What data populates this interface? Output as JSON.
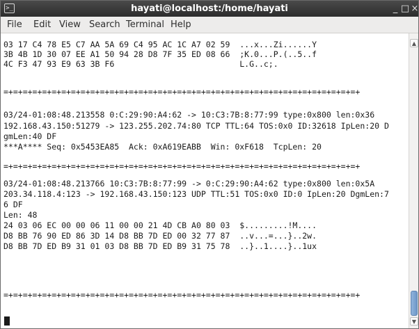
{
  "window": {
    "title": "hayati@localhost:/home/hayati",
    "app_icon": "terminal-icon",
    "minimize_glyph": "_",
    "maximize_glyph": "□",
    "close_glyph": "×"
  },
  "menu": [
    "File",
    "Edit",
    "View",
    "Search",
    "Terminal",
    "Help"
  ],
  "terminal": {
    "lines": [
      "03 17 C4 78 E5 C7 AA 5A 69 C4 95 AC 1C A7 02 59  ...x...Zi......Y",
      "3B 4B 1D 30 07 EE A1 50 94 28 D8 7F 35 ED 08 66  ;K.0...P.(..5..f",
      "4C F3 47 93 E9 63 3B F6                          L.G..c;.",
      "",
      "=+=+=+=+=+=+=+=+=+=+=+=+=+=+=+=+=+=+=+=+=+=+=+=+=+=+=+=+=+=+=+=+=+=+=+=+=+",
      "",
      "03/24-01:08:48.213558 0:C:29:90:A4:62 -> 10:C3:7B:8:77:99 type:0x800 len:0x36",
      "192.168.43.150:51279 -> 123.255.202.74:80 TCP TTL:64 TOS:0x0 ID:32618 IpLen:20 D",
      "gmLen:40 DF",
      "***A**** Seq: 0x5453EA85  Ack: 0xA619EABB  Win: 0xF618  TcpLen: 20",
      "",
      "=+=+=+=+=+=+=+=+=+=+=+=+=+=+=+=+=+=+=+=+=+=+=+=+=+=+=+=+=+=+=+=+=+=+=+=+=+",
      "",
      "03/24-01:08:48.213766 10:C3:7B:8:77:99 -> 0:C:29:90:A4:62 type:0x800 len:0x5A",
      "203.34.118.4:123 -> 192.168.43.150:123 UDP TTL:51 TOS:0x0 ID:0 IpLen:20 DgmLen:7",
      "6 DF",
      "Len: 48",
      "24 03 06 EC 00 00 06 11 00 00 21 4D CB A0 80 03  $.........!M....",
      "D8 BB 76 90 ED 86 3D 14 D8 BB 7D ED 00 32 77 87  ..v...=...}..2w.",
      "D8 BB 7D ED B9 31 01 03 D8 BB 7D ED B9 31 75 78  ..}..1....}..1ux",
      "",
      "=+=+=+=+=+=+=+=+=+=+=+=+=+=+=+=+=+=+=+=+=+=+=+=+=+=+=+=+=+=+=+=+=+=+=+=+=+",
      ""
    ]
  },
  "colors": {
    "titlebar": "#3a3a3a",
    "menubar": "#edeceb",
    "terminal_bg": "#ffffff",
    "terminal_fg": "#1a1a1a",
    "scroll_thumb": "#7aa1cf"
  }
}
